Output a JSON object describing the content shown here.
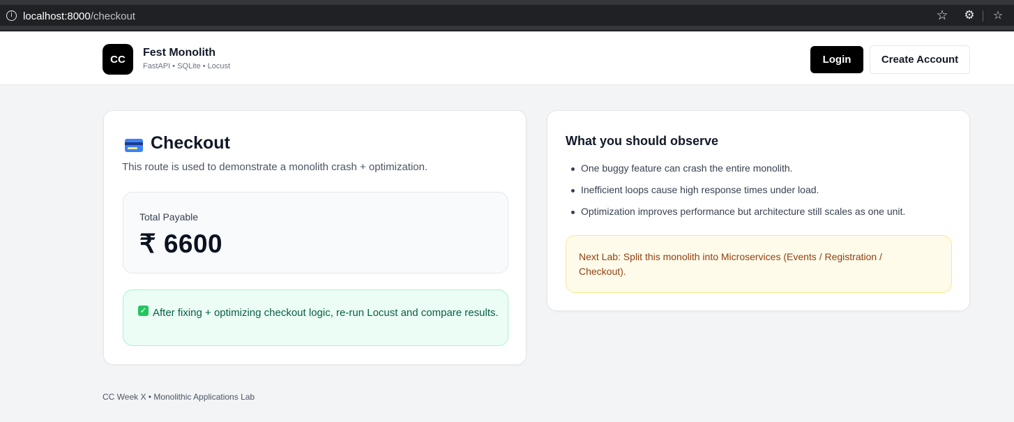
{
  "browser": {
    "url_host": "localhost:8000",
    "url_path": "/checkout",
    "icons": {
      "info": "info-icon",
      "star": "star-icon",
      "extensions": "extensions-icon",
      "favorites": "favorites-icon"
    }
  },
  "header": {
    "logo_text": "CC",
    "brand_title": "Fest Monolith",
    "brand_subtitle": "FastAPI • SQLite • Locust",
    "login_label": "Login",
    "create_account_label": "Create Account"
  },
  "checkout": {
    "title": "Checkout",
    "icon": "credit-card-icon",
    "description": "This route is used to demonstrate a monolith crash + optimization.",
    "total_label": "Total Payable",
    "total_value": "₹ 6600",
    "success_icon": "check-icon",
    "success_message": "After fixing + optimizing checkout logic, re-run Locust and compare results."
  },
  "observe": {
    "title": "What you should observe",
    "items": [
      "One buggy feature can crash the entire monolith.",
      "Inefficient loops cause high response times under load.",
      "Optimization improves performance but architecture still scales as one unit."
    ],
    "note": "Next Lab: Split this monolith into Microservices (Events / Registration / Checkout)."
  },
  "footer": {
    "text": "CC Week X • Monolithic Applications Lab"
  },
  "colors": {
    "page_bg": "#f3f4f6",
    "primary": "#000000",
    "success_bg": "#ecfdf5",
    "success_text": "#065f46",
    "note_bg": "#fffbeb",
    "note_text": "#92400e"
  }
}
